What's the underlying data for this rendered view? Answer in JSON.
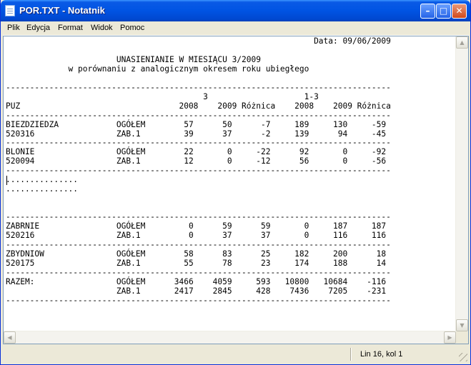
{
  "window": {
    "title": "POR.TXT - Notatnik"
  },
  "titlebar": {
    "min_glyph": "–",
    "max_glyph": "□",
    "close_glyph": "✕"
  },
  "menu": [
    {
      "label": "Plik"
    },
    {
      "label": "Edycja"
    },
    {
      "label": "Format"
    },
    {
      "label": "Widok"
    },
    {
      "label": "Pomoc"
    }
  ],
  "editor": {
    "lines": [
      "                                                                Data: 09/06/2009",
      "",
      "                       UNASIENIANIE W MIESIĄCU 3/2009",
      "             w porównaniu z analogicznym okresem roku ubiegłego",
      "",
      "--------------------------------------------------------------------------------",
      "                                         3                    1-3",
      "PUZ                                 2008    2009 Różnica    2008    2009 Różnica",
      "--------------------------------------------------------------------------------",
      "BIEZDZIEDZA            OGÓŁEM        57      50      -7     189     130     -59",
      "520316                 ZAB.1         39      37      -2     139      94     -45",
      "--------------------------------------------------------------------------------",
      "BLONIE                 OGÓŁEM        22       0     -22      92       0     -92",
      "520094                 ZAB.1         12       0     -12      56       0     -56",
      "--------------------------------------------------------------------------------",
      "...............",
      "...............",
      "",
      "",
      "--------------------------------------------------------------------------------",
      "ZABRNIE                OGÓŁEM         0      59      59       0     187     187",
      "520216                 ZAB.1          0      37      37       0     116     116",
      "--------------------------------------------------------------------------------",
      "ZBYDNIOW               OGÓŁEM        58      83      25     182     200      18",
      "520175                 ZAB.1         55      78      23     174     188      14",
      "--------------------------------------------------------------------------------",
      "RAZEM:                 OGÓŁEM      3466    4059     593   10800   10684    -116",
      "                       ZAB.1       2417    2845     428    7436    7205    -231",
      "--------------------------------------------------------------------------------"
    ]
  },
  "scrollbar": {
    "up": "▲",
    "down": "▼",
    "left": "◀",
    "right": "▶"
  },
  "status": {
    "position": "Lin 16, kol 1"
  }
}
